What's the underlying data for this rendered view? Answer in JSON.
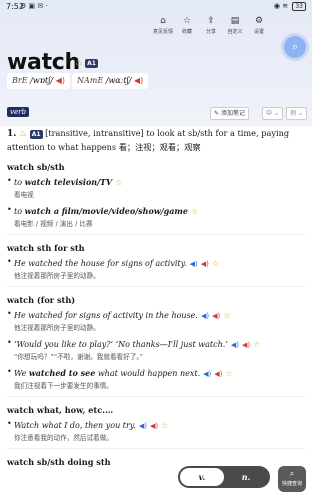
{
  "status": {
    "time": "7:52",
    "battery": "33"
  },
  "toolbar": {
    "items": [
      {
        "label": "意见反馈",
        "icon": "feedback-icon"
      },
      {
        "label": "收藏",
        "icon": "star-icon"
      },
      {
        "label": "分享",
        "icon": "share-icon"
      },
      {
        "label": "自定义",
        "icon": "customize-icon"
      },
      {
        "label": "设置",
        "icon": "gear-icon"
      }
    ]
  },
  "entry": {
    "headword": "watch",
    "level": "A1",
    "pron_uk": {
      "region": "BrE",
      "ipa": "/wɒtʃ/"
    },
    "pron_us": {
      "region": "NAmE",
      "ipa": "/wɑːtʃ/"
    },
    "pos": "verb",
    "note_label": "添加笔记",
    "dropdown1": "中",
    "dropdown2": "例"
  },
  "sense1": {
    "num": "1.",
    "level": "A1",
    "definition": "[transitive, intransitive] to look at sb/sth for a time, paying attention to what happens 看；注视；观看；观察"
  },
  "sections": [
    {
      "heading": "watch sb/sth",
      "examples": [
        {
          "pre": "to ",
          "bold": "watch television/TV",
          "post": "",
          "zh": "看电视",
          "speakers": false
        },
        {
          "pre": "to ",
          "bold": "watch a film/movie/video/show/game",
          "post": "",
          "zh": "看电影 / 视频 / 演出 / 比赛",
          "speakers": false
        }
      ]
    },
    {
      "heading": "watch sth for sth",
      "examples": [
        {
          "pre": "He watched the house for signs of activity.",
          "bold": "",
          "post": "",
          "zh": "他注视着那所房子里的动静。",
          "speakers": true
        }
      ]
    },
    {
      "heading": "watch (for sth)",
      "examples": [
        {
          "pre": "He watched for signs of activity in the house.",
          "bold": "",
          "post": "",
          "zh": "他注视着那所房子里的动静。",
          "speakers": true
        },
        {
          "pre": "‘Would you like to play?’ ‘No thanks—I'll just watch.’",
          "bold": "",
          "post": "",
          "zh": "“你想玩吗？”“不啦，谢谢。我就看看好了。”",
          "speakers": true
        },
        {
          "pre": "We ",
          "bold": "watched to see",
          "post": " what would happen next.",
          "zh": "我们注视着下一步要发生的事情。",
          "speakers": true
        }
      ]
    },
    {
      "heading": "watch what, how, etc.…",
      "examples": [
        {
          "pre": "Watch what I do, then you try.",
          "bold": "",
          "post": "",
          "zh": "你注意看我的动作，然后试着做。",
          "speakers": true
        }
      ]
    },
    {
      "heading": "watch sb/sth doing sth",
      "examples": []
    }
  ],
  "bottom": {
    "tab_v": "v.",
    "tab_n": "n.",
    "quick_label": "快捷查询"
  }
}
